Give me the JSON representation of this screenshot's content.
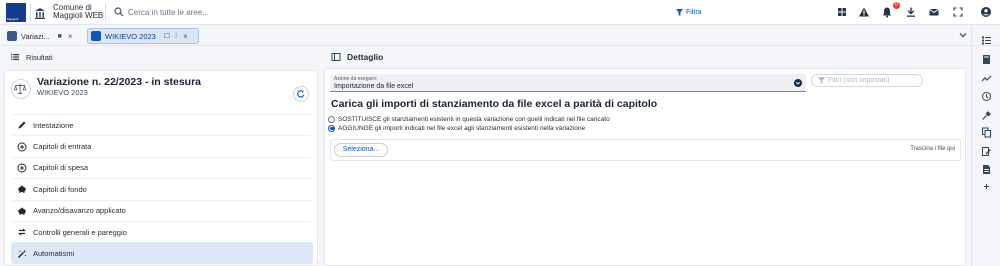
{
  "header": {
    "logo_text": "Maggioli",
    "org_line1": "Comune di",
    "org_line2": "Maggioli WEB",
    "search_placeholder": "Cerca in tutte le aree...",
    "filter_label": "Filtra",
    "notification_count": "0"
  },
  "tabs": [
    {
      "label": "Variazi...",
      "pin": "■",
      "close": "×"
    },
    {
      "label": "WIKIEVO 2023",
      "pin": "☐",
      "sep": "⁞",
      "close": "×"
    }
  ],
  "left": {
    "results_label": "Risultati",
    "title": "Variazione n. 22/2023 - in stesura",
    "subtitle": "WIKIEVO 2023",
    "menu": [
      {
        "label": "Intestazione",
        "icon": "pencil-icon"
      },
      {
        "label": "Capitoli di entrata",
        "icon": "circle-plus-icon"
      },
      {
        "label": "Capitoli di spesa",
        "icon": "circle-minus-icon"
      },
      {
        "label": "Capitoli di fondo",
        "icon": "piggy-bank-icon"
      },
      {
        "label": "Avanzo/disavanzo applicato",
        "icon": "piggy-bank-icon"
      },
      {
        "label": "Controlli generali e pareggio",
        "icon": "swap-icon"
      },
      {
        "label": "Automatismi",
        "icon": "magic-wand-icon"
      }
    ]
  },
  "right": {
    "title": "Dettaglio",
    "action_label": "Azione da eseguire",
    "action_value": "Importazione da file excel",
    "filters_label": "Filtri (non impostati)",
    "section_title": "Carica gli importi di stanziamento da file excel a parità di capitolo",
    "options": [
      {
        "label": "SOSTITUISCE gli stanziamenti esistenti in questa variazione con quelli indicati nel file caricato",
        "checked": false
      },
      {
        "label": "AGGIUNGE gli importi indicati nel file excel agli stanziamenti esistenti nella variazione",
        "checked": true
      }
    ],
    "select_button": "Seleziona...",
    "drag_hint": "Trascina i file qui"
  }
}
